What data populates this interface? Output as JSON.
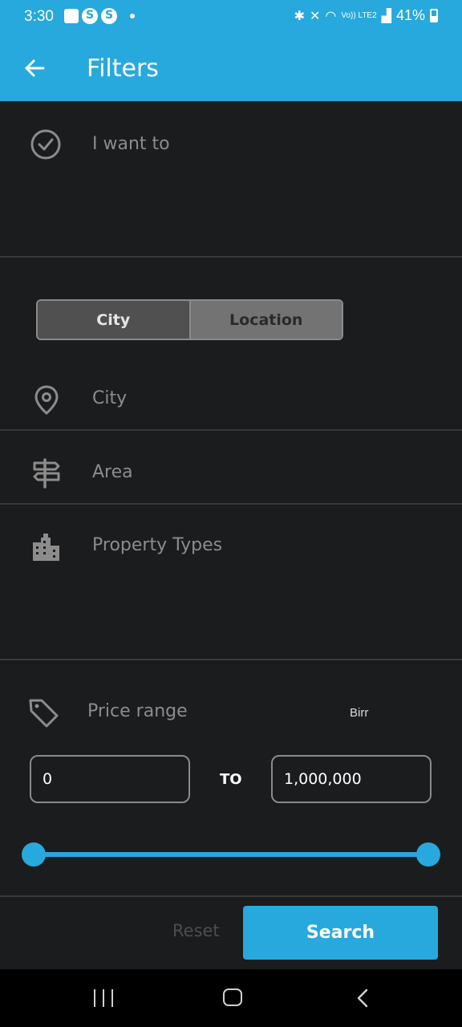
{
  "status_bar": {
    "time": "3:30",
    "network": "Vo)) LTE2",
    "battery": "41%"
  },
  "app_bar": {
    "title": "Filters",
    "back_icon": "arrow-left-icon"
  },
  "i_want_to": {
    "label": "I want to",
    "icon": "check-circle-icon"
  },
  "segment": {
    "options": [
      "City",
      "Location"
    ],
    "selected": "City"
  },
  "city": {
    "label": "City",
    "icon": "map-pin-icon"
  },
  "area": {
    "label": "Area",
    "icon": "signpost-icon"
  },
  "property_types": {
    "label": "Property Types",
    "icon": "buildings-icon"
  },
  "price": {
    "label": "Price range",
    "icon": "tag-icon",
    "unit": "Birr",
    "min_value": "0",
    "to_label": "TO",
    "max_value": "1,000,000",
    "slider_min_fraction": 0,
    "slider_max_fraction": 1
  },
  "actions": {
    "reset_label": "Reset",
    "search_label": "Search"
  },
  "colors": {
    "accent": "#27a9dd",
    "background": "#1b1c1e"
  }
}
